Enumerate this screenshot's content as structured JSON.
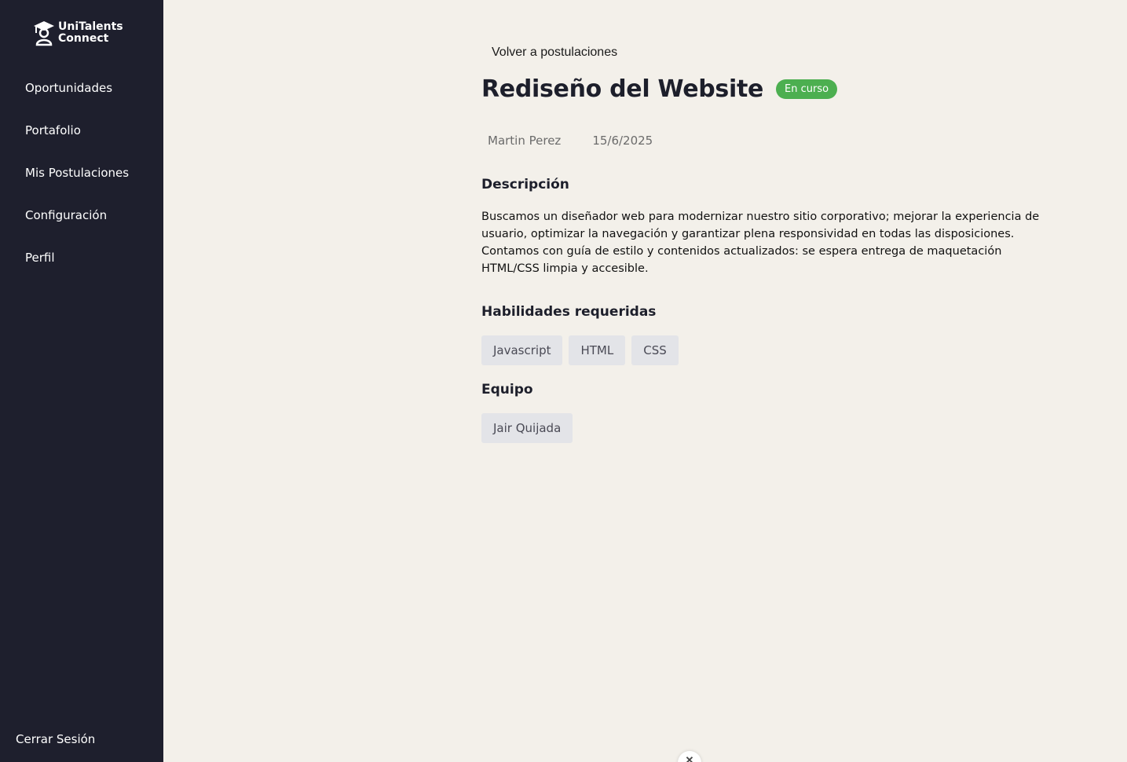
{
  "brand": {
    "line1": "UniTalents",
    "line2": "Connect"
  },
  "sidebar": {
    "items": [
      {
        "label": "Oportunidades"
      },
      {
        "label": "Portafolio"
      },
      {
        "label": "Mis Postulaciones"
      },
      {
        "label": "Configuración"
      },
      {
        "label": "Perfil"
      }
    ],
    "logout_label": "Cerrar Sesión"
  },
  "main": {
    "back_label": "Volver a postulaciones",
    "title": "Rediseño del Website",
    "status": "En curso",
    "author": "Martin Perez",
    "date": "15/6/2025",
    "description_heading": "Descripción",
    "description": "Buscamos un diseñador web para modernizar nuestro sitio corporativo; mejorar la experiencia de usuario, optimizar la navegación y garantizar plena responsividad en todas las disposiciones. Contamos con guía de estilo y contenidos actualizados: se espera entrega de maquetación HTML/CSS limpia y accesible.",
    "skills_heading": "Habilidades requeridas",
    "skills": [
      "Javascript",
      "HTML",
      "CSS"
    ],
    "team_heading": "Equipo",
    "team": [
      "Jair Quijada"
    ]
  },
  "colors": {
    "sidebar_bg": "#1e1f2d",
    "page_bg": "#f3f0ea",
    "status_badge": "#4caf50",
    "chip_bg": "#e3e4e8"
  },
  "icons": {
    "logo": "graduation-cap-person-icon",
    "close": "close-icon"
  }
}
